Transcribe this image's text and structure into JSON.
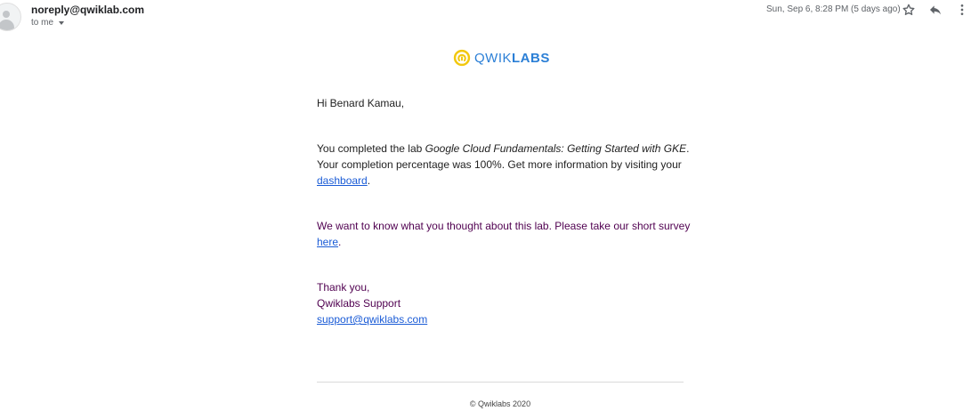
{
  "header": {
    "sender": "noreply@qwiklab.com",
    "recipient": "to me",
    "datetime": "Sun, Sep 6, 8:28 PM (5 days ago)",
    "icons": [
      "person-icon",
      "star-icon",
      "reply-icon",
      "more-vert-icon"
    ]
  },
  "logo": {
    "text_light": "QWIK",
    "text_bold": "LABS",
    "colors": {
      "mark": "#f2c80f",
      "text": "#2b7fd6"
    }
  },
  "body": {
    "greeting": "Hi Benard Kamau,",
    "completion": {
      "prefix": "You completed the lab ",
      "lab_title": "Google Cloud Fundamentals: Getting Started with GKE",
      "middle": ". Your completion percentage was 100%. Get more information by visiting your ",
      "link": "dashboard",
      "suffix": "."
    },
    "survey": {
      "text": "We want to know what you thought about this lab. Please take our short survey ",
      "link": "here",
      "suffix": "."
    },
    "signoff": {
      "thanks": "Thank you,",
      "team": "Qwiklabs Support",
      "email": "support@qwiklabs.com"
    }
  },
  "footer": {
    "copyright": "© Qwiklabs 2020"
  },
  "colors": {
    "link": "#1a5bd6",
    "quoted_text": "#500050"
  }
}
